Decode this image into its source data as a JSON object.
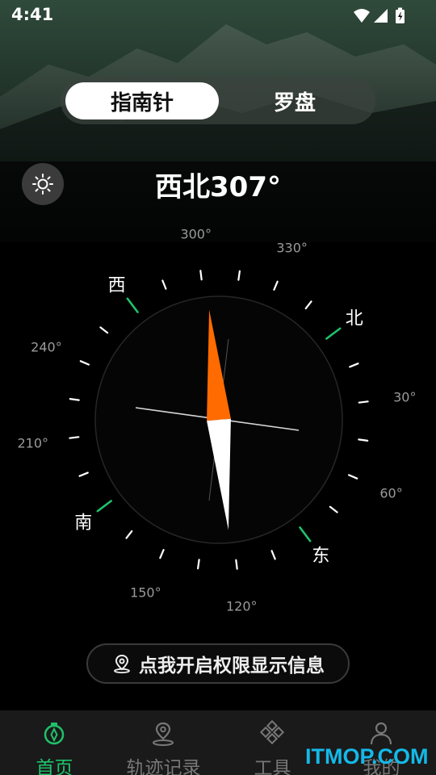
{
  "status_bar": {
    "time": "4:41"
  },
  "mode_switch": {
    "tabs": [
      "指南针",
      "罗盘"
    ],
    "active_index": 0
  },
  "heading": {
    "text": "西北307°"
  },
  "compass": {
    "heading_deg": 307,
    "degree_labels": [
      "300°",
      "330°",
      "30°",
      "60°",
      "120°",
      "150°",
      "210°",
      "240°"
    ],
    "cardinals": {
      "north": "北",
      "east": "东",
      "south": "南",
      "west": "西"
    },
    "needle_colors": {
      "north": "#ff6b00",
      "south": "#ffffff"
    },
    "cardinal_tick_color": "#1fc26a"
  },
  "permission_button": {
    "label": "点我开启权限显示信息"
  },
  "bottom_nav": {
    "items": [
      {
        "label": "首页",
        "icon": "compass-icon",
        "active": true
      },
      {
        "label": "轨迹记录",
        "icon": "location-pin-icon",
        "active": false
      },
      {
        "label": "工具",
        "icon": "tools-icon",
        "active": false
      },
      {
        "label": "我的",
        "icon": "person-icon",
        "active": false
      }
    ],
    "active_color": "#1fc26a"
  },
  "watermark": {
    "text": "ITMOP.COM"
  }
}
